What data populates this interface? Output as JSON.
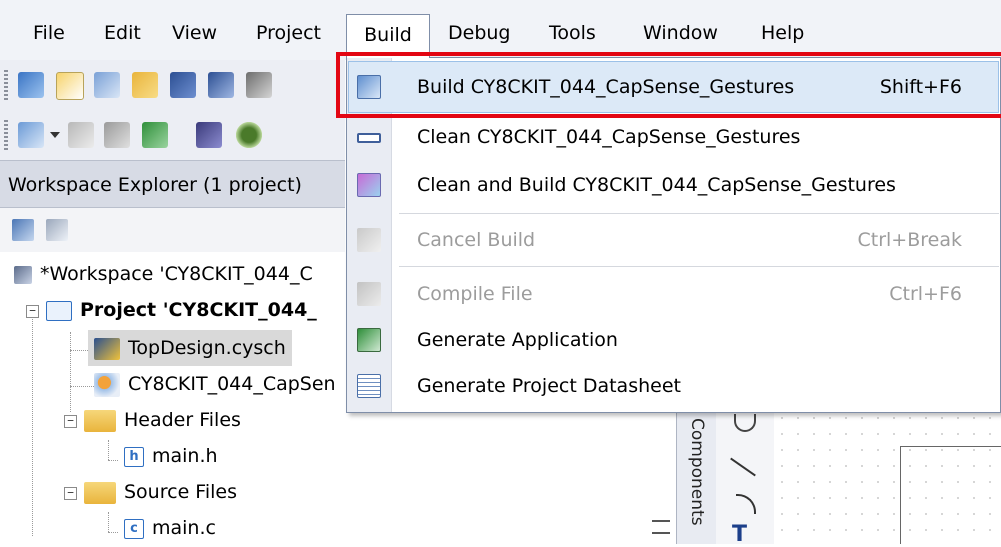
{
  "menubar": {
    "items": [
      {
        "label": "File"
      },
      {
        "label": "Edit"
      },
      {
        "label": "View"
      },
      {
        "label": "Project"
      },
      {
        "label": "Build"
      },
      {
        "label": "Debug"
      },
      {
        "label": "Tools"
      },
      {
        "label": "Window"
      },
      {
        "label": "Help"
      }
    ]
  },
  "toolbar1": {
    "icons": [
      "new-project-icon",
      "new-item-icon",
      "add-item-icon",
      "open-folder-icon",
      "save-icon",
      "save-all-icon",
      "print-icon"
    ]
  },
  "toolbar2": {
    "icons": [
      "build-icon",
      "dropdown-arrow-icon",
      "cancel-build-icon",
      "compile-icon",
      "generate-application-icon",
      "program-icon",
      "debug-bug-icon"
    ]
  },
  "workspace_explorer": {
    "title": "Workspace Explorer (1 project)",
    "tree": [
      {
        "label": "*Workspace 'CY8CKIT_044_C",
        "icon": "workspace-icon"
      },
      {
        "label": "Project  'CY8CKIT_044_",
        "icon": "project-icon"
      },
      {
        "label": "TopDesign.cysch",
        "icon": "schematic-icon"
      },
      {
        "label": "CY8CKIT_044_CapSen",
        "icon": "design-wide-resources-icon"
      },
      {
        "label": "Header Files",
        "icon": "folder-icon"
      },
      {
        "label": "main.h",
        "icon": "header-file-icon"
      },
      {
        "label": "Source Files",
        "icon": "folder-icon"
      },
      {
        "label": "main.c",
        "icon": "c-file-icon"
      }
    ]
  },
  "build_menu": {
    "items": [
      {
        "label": "Build CY8CKIT_044_CapSense_Gestures",
        "shortcut": "Shift+F6",
        "enabled": true
      },
      {
        "label": "Clean CY8CKIT_044_CapSense_Gestures",
        "shortcut": "",
        "enabled": true
      },
      {
        "label": "Clean and Build CY8CKIT_044_CapSense_Gestures",
        "shortcut": "",
        "enabled": true
      },
      {
        "label": "Cancel Build",
        "shortcut": "Ctrl+Break",
        "enabled": false
      },
      {
        "label": "Compile File",
        "shortcut": "Ctrl+F6",
        "enabled": false
      },
      {
        "label": "Generate Application",
        "shortcut": "",
        "enabled": true
      },
      {
        "label": "Generate Project Datasheet",
        "shortcut": "",
        "enabled": true
      }
    ]
  },
  "side_panel": {
    "components_tab": "Components"
  },
  "colors": {
    "highlight_border": "#e30613",
    "menu_hover": "#dce9f7"
  }
}
